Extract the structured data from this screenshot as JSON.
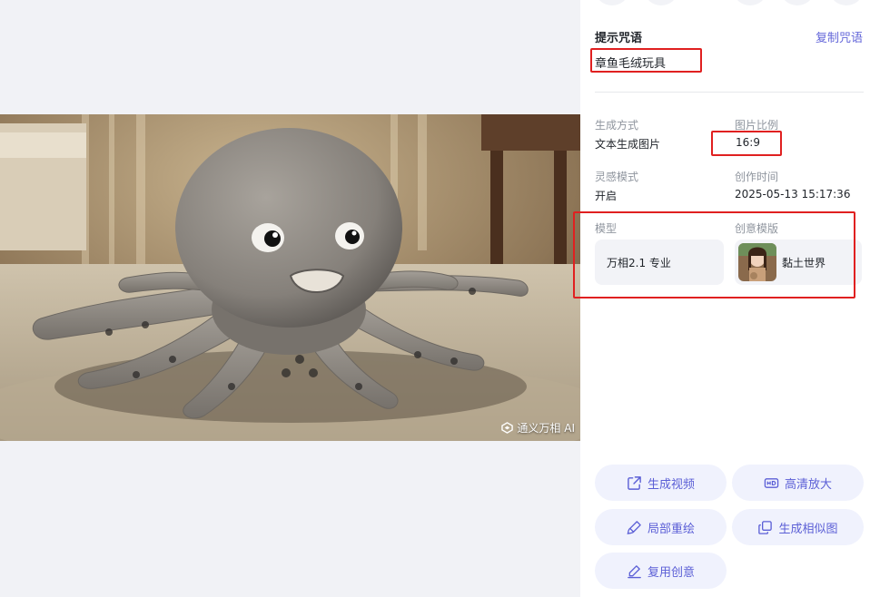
{
  "image": {
    "watermark_text": "通义万相 AI",
    "subject": "octopus-plush-photo"
  },
  "prompt": {
    "title": "提示咒语",
    "copy_label": "复制咒语",
    "text": "章鱼毛绒玩具"
  },
  "meta": {
    "generation_method_label": "生成方式",
    "generation_method_value": "文本生成图片",
    "aspect_ratio_label": "图片比例",
    "aspect_ratio_value": "16:9",
    "inspiration_mode_label": "灵感模式",
    "inspiration_mode_value": "开启",
    "created_time_label": "创作时间",
    "created_time_value": "2025-05-13 15:17:36",
    "model_label": "模型",
    "model_value": "万相2.1 专业",
    "template_label": "创意模版",
    "template_value": "黏土世界"
  },
  "actions": {
    "generate_video": "生成视频",
    "hd_upscale": "高清放大",
    "inpaint": "局部重绘",
    "similar": "生成相似图",
    "reuse": "复用创意"
  },
  "colors": {
    "accent": "#5b5fd6",
    "highlight_box": "#e02020",
    "button_bg": "#f0f2fd",
    "page_bg": "#f1f2f6"
  }
}
